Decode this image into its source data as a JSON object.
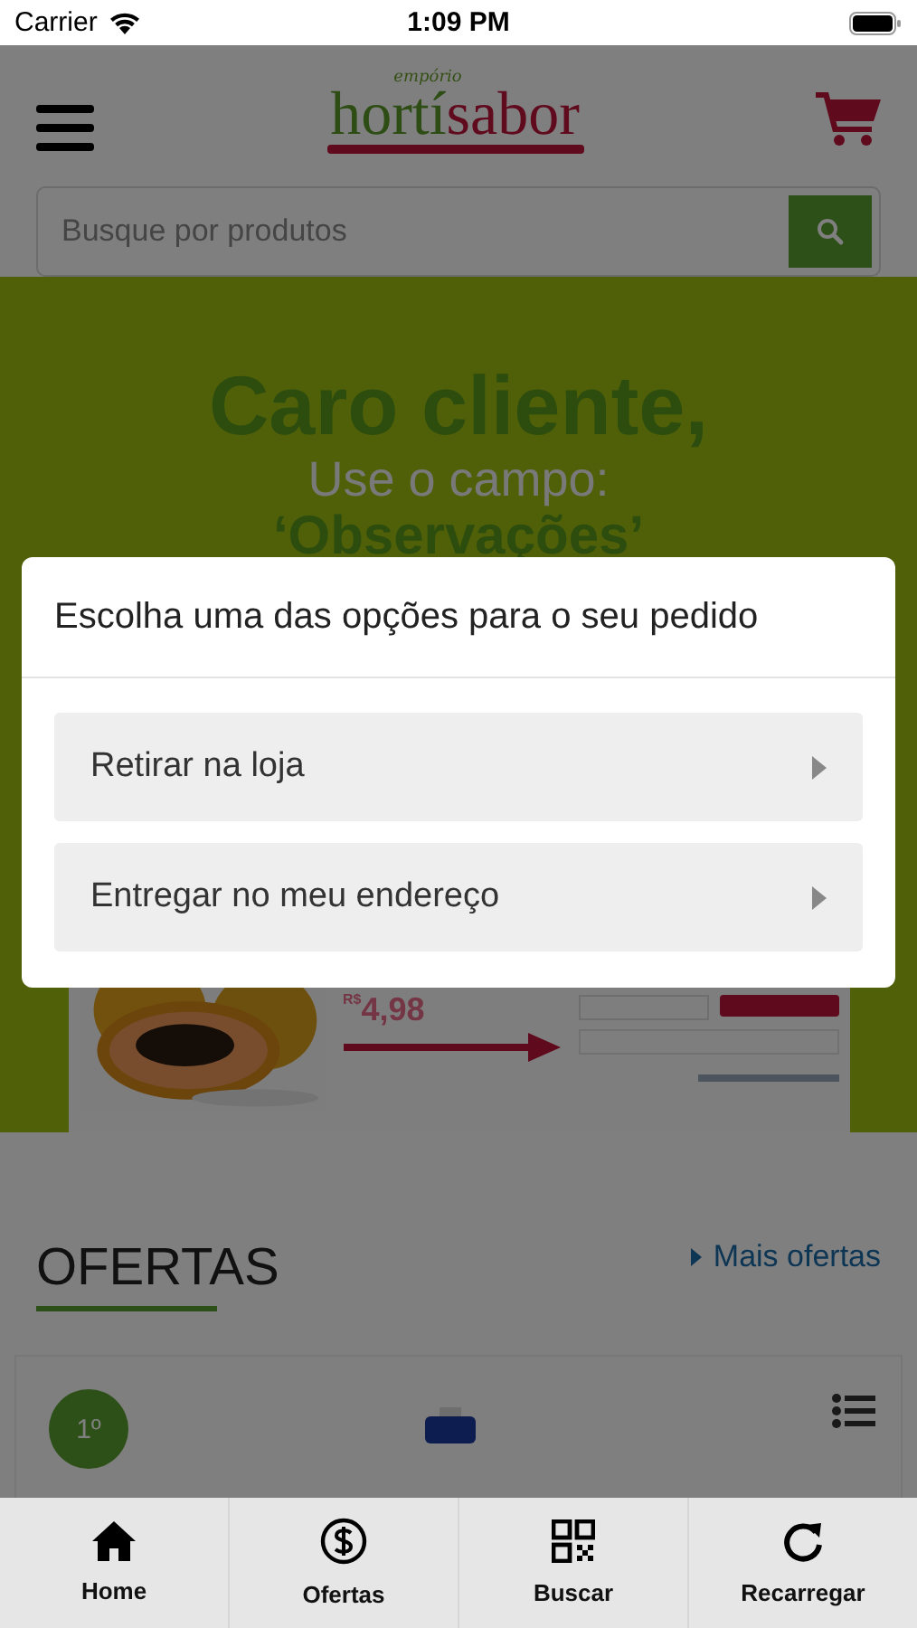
{
  "status_bar": {
    "carrier": "Carrier",
    "time": "1:09 PM"
  },
  "header": {
    "logo": {
      "tagline": "empório",
      "word_green": "hortí",
      "word_red": "sabor"
    },
    "search": {
      "placeholder": "Busque por produtos"
    }
  },
  "banner": {
    "headline": "Caro cliente,",
    "subline": "Use o campo:",
    "field_name": "‘Observações’",
    "price": "4,98",
    "currency": "R$"
  },
  "offers": {
    "title": "OFERTAS",
    "more_link": "Mais ofertas",
    "card": {
      "rank": "1º"
    }
  },
  "dialog": {
    "title": "Escolha uma das opções para o seu pedido",
    "options": [
      {
        "label": "Retirar na loja"
      },
      {
        "label": "Entregar no meu endereço"
      }
    ]
  },
  "tab_bar": [
    {
      "kind": "home",
      "label": "Home"
    },
    {
      "kind": "dollar",
      "label": "Ofertas"
    },
    {
      "kind": "qr",
      "label": "Buscar"
    },
    {
      "kind": "reload",
      "label": "Recarregar"
    }
  ]
}
